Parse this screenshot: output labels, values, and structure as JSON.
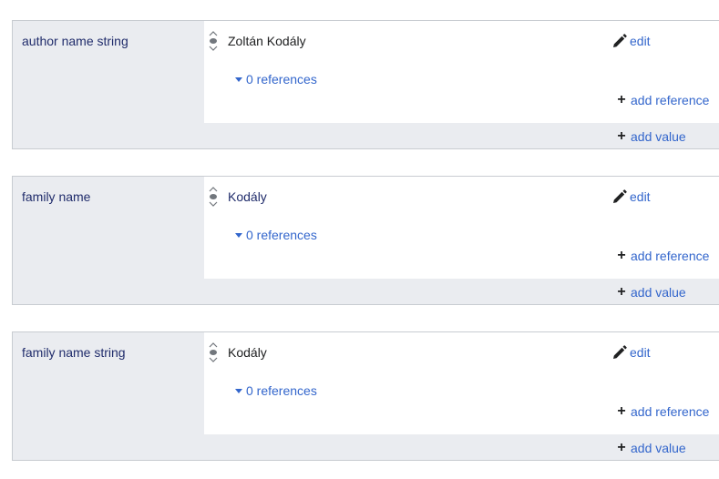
{
  "statements": [
    {
      "property": "author name string",
      "value": "Zoltán Kodály",
      "edit_label": "edit",
      "references_label": "0 references",
      "add_reference_label": "add reference",
      "add_value_label": "add value"
    },
    {
      "property": "family name",
      "value": "Kodály",
      "edit_label": "edit",
      "references_label": "0 references",
      "add_reference_label": "add reference",
      "add_value_label": "add value"
    },
    {
      "property": "family name string",
      "value": "Kodály",
      "edit_label": "edit",
      "references_label": "0 references",
      "add_reference_label": "add reference",
      "add_value_label": "add value"
    }
  ],
  "icons": {
    "rank": "rank-normal-icon",
    "edit": "pencil-icon",
    "add": "plus-icon",
    "toggle": "caret-down-icon"
  },
  "colors": {
    "link": "#3366cc",
    "property_label": "#202c6b",
    "group_background": "#eaecf0",
    "border": "#c8ccd1"
  }
}
